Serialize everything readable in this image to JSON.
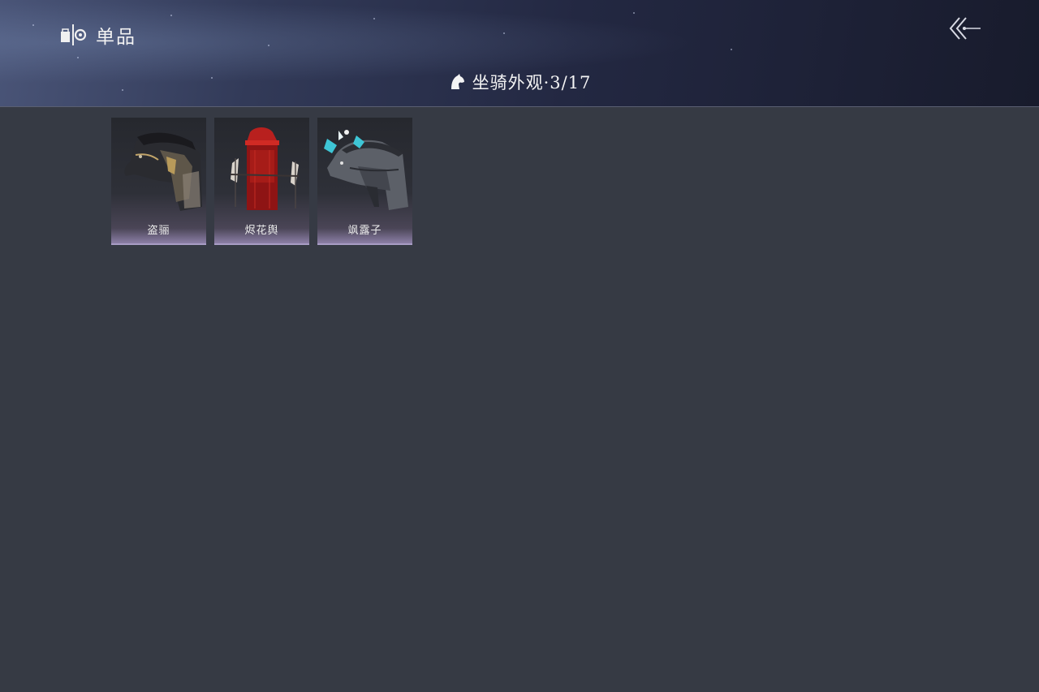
{
  "header": {
    "title": "单品",
    "subtitle": "坐骑外观·3/17"
  },
  "items": [
    {
      "label": "盗骊",
      "icon": "dark-armored-horse-art"
    },
    {
      "label": "烬花舆",
      "icon": "red-palanquin-art"
    },
    {
      "label": "飒露子",
      "icon": "grey-horse-with-flowers-art"
    }
  ]
}
